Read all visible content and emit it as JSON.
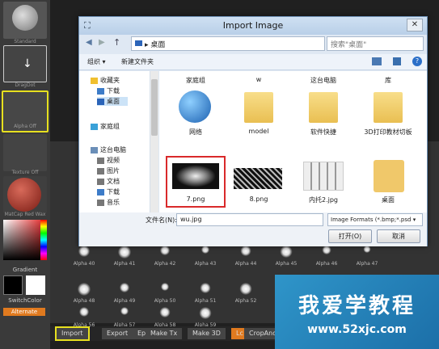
{
  "left_panel": {
    "tiles": [
      {
        "label": "Standard"
      },
      {
        "label": "DragDot"
      },
      {
        "label": "Alpha Off"
      },
      {
        "label": "Texture Off"
      },
      {
        "label": "MatCap Red Wax"
      }
    ],
    "gradient_label": "Gradient",
    "switch_label": "SwitchColor",
    "alternate_label": "Alternate"
  },
  "alphas": {
    "row1": [
      "Alpha 40",
      "Alpha 41",
      "Alpha 42",
      "Alpha 43",
      "Alpha 44",
      "Alpha 45",
      "Alpha 46",
      "Alpha 47"
    ],
    "row2": [
      "Alpha 48",
      "Alpha 49",
      "Alpha 50",
      "Alpha 51",
      "Alpha 52"
    ],
    "row3": [
      "Alpha 56",
      "Alpha 57",
      "Alpha 58",
      "Alpha 59"
    ]
  },
  "bottom_bar": {
    "import": "Import",
    "export": "Export",
    "ep": "Ep",
    "make_tx": "Make Tx",
    "make_3d": "Make 3D",
    "lc": "Lc",
    "crop": "CropAndF"
  },
  "dialog": {
    "title": "Import Image",
    "close": "✕",
    "address": "桌面",
    "address_sep": "▸",
    "search_placeholder": "搜索\"桌面\"",
    "toolbar": {
      "organize": "组织 ▾",
      "new_folder": "新建文件夹"
    },
    "nav": [
      {
        "label": "收藏夹"
      },
      {
        "label": "下载"
      },
      {
        "label": "桌面"
      },
      {
        "label": "家庭组"
      },
      {
        "label": "这台电脑"
      },
      {
        "label": "视频"
      },
      {
        "label": "图片"
      },
      {
        "label": "文档"
      },
      {
        "label": "下载"
      },
      {
        "label": "音乐"
      }
    ],
    "files_top": [
      "家庭组",
      "w",
      "这台电脑",
      "库"
    ],
    "files_mid": [
      "网络",
      "model",
      "软件快捷",
      "3D打印教材切板"
    ],
    "files_bottom": [
      "7.png",
      "8.png",
      "内托2.jpg",
      "桌面"
    ],
    "filename_label": "文件名(N):",
    "filename_value": "wu.jpg",
    "filetype": "Image Formats (*.bmp;*.psd ▾",
    "open": "打开(O)",
    "cancel": "取消"
  },
  "watermark": {
    "line1": "我爱学教程",
    "line2": "www.52xjc.com"
  },
  "colors": {
    "highlight": "#e7e01f",
    "selection": "#d9292a",
    "alternate": "#e07a1f"
  }
}
